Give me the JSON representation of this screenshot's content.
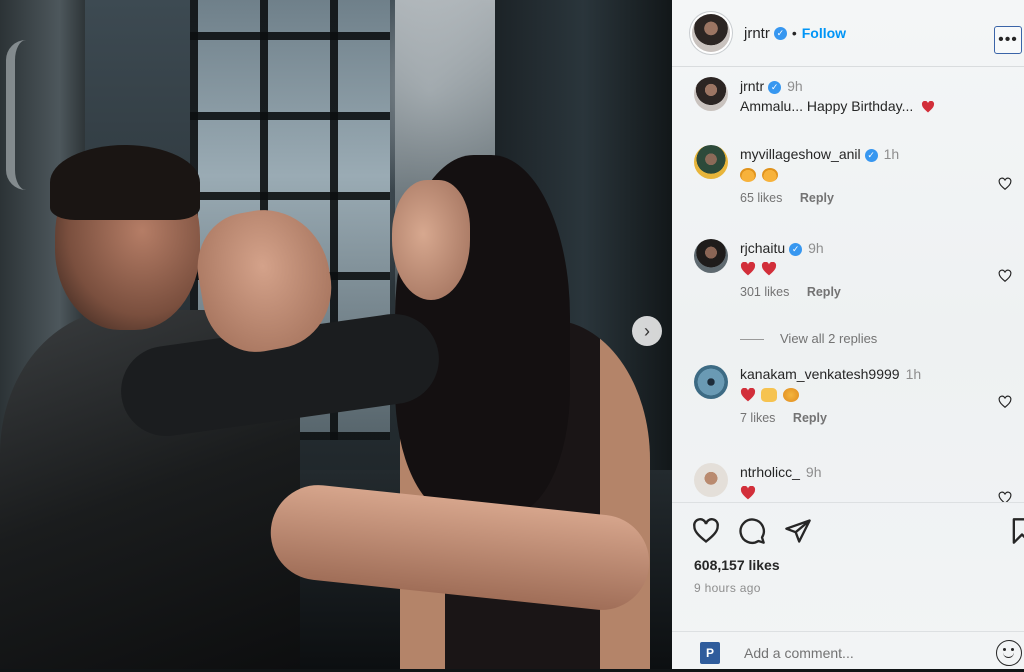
{
  "post": {
    "author": "jrntr",
    "follow_label": "Follow",
    "separator": "•",
    "more_label": "•••",
    "next_label": "›"
  },
  "caption": {
    "username": "jrntr",
    "time": "9h",
    "text": "Ammalu... Happy Birthday..."
  },
  "comments": [
    {
      "username": "myvillageshow_anil",
      "verified": true,
      "time": "1h",
      "emojis": [
        "smiling-face-hearts",
        "smiling-face-hearts"
      ],
      "likes": "65 likes",
      "reply": "Reply"
    },
    {
      "username": "rjchaitu",
      "verified": true,
      "time": "9h",
      "emojis": [
        "red-heart",
        "red-heart"
      ],
      "likes": "301 likes",
      "reply": "Reply"
    },
    {
      "username": "kanakam_venkatesh9999",
      "verified": false,
      "time": "1h",
      "emojis": [
        "red-heart",
        "raising-hands",
        "smiling-face-hearts"
      ],
      "likes": "7 likes",
      "reply": "Reply"
    },
    {
      "username": "ntrholicc_",
      "verified": false,
      "time": "9h",
      "emojis": [
        "red-heart"
      ]
    }
  ],
  "view_replies_label": "View all 2 replies",
  "likes_total": "608,157 likes",
  "posted_ago": "9 hours ago",
  "comment_box": {
    "placeholder": "Add a comment...",
    "app_icon_letter": "P"
  },
  "colors": {
    "accent": "#0095f6",
    "verified": "#3797f0",
    "heart": "#ed4956"
  }
}
